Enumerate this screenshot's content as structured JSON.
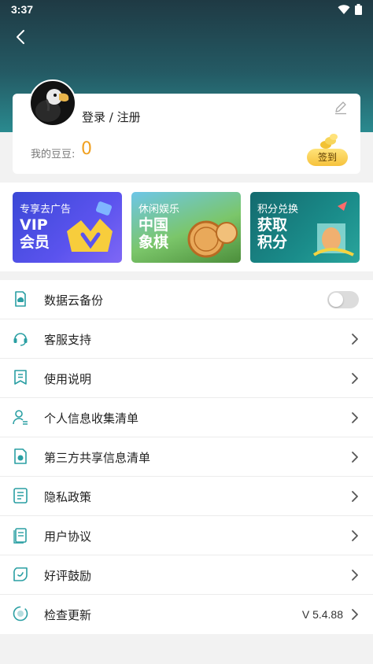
{
  "status_bar": {
    "time": "3:37"
  },
  "profile": {
    "login_label": "登录 / 注册",
    "beans_label": "我的豆豆:",
    "beans_value": "0",
    "checkin_label": "签到"
  },
  "banners": [
    {
      "subtitle": "专享去广告",
      "title": "VIP 会员"
    },
    {
      "subtitle": "休闲娱乐",
      "title": "中国 象棋"
    },
    {
      "subtitle": "积分兑换",
      "title": "获取 积分"
    }
  ],
  "menu": {
    "items": [
      {
        "label": "数据云备份",
        "icon": "cloud-backup-icon",
        "control": "toggle",
        "toggle_on": false
      },
      {
        "label": "客服支持",
        "icon": "headset-icon",
        "control": "chevron"
      },
      {
        "label": "使用说明",
        "icon": "manual-icon",
        "control": "chevron"
      },
      {
        "label": "个人信息收集清单",
        "icon": "user-info-icon",
        "control": "chevron"
      },
      {
        "label": "第三方共享信息清单",
        "icon": "share-info-icon",
        "control": "chevron"
      },
      {
        "label": "隐私政策",
        "icon": "privacy-icon",
        "control": "chevron"
      },
      {
        "label": "用户协议",
        "icon": "agreement-icon",
        "control": "chevron"
      },
      {
        "label": "好评鼓励",
        "icon": "rating-icon",
        "control": "chevron"
      },
      {
        "label": "检查更新",
        "icon": "update-icon",
        "control": "chevron",
        "value": "V 5.4.88"
      }
    ]
  },
  "colors": {
    "accent": "#2a9fa3",
    "beans_orange": "#f0a020",
    "checkin_gold": "#f6c23c",
    "header_dark": "#1f3a44"
  }
}
